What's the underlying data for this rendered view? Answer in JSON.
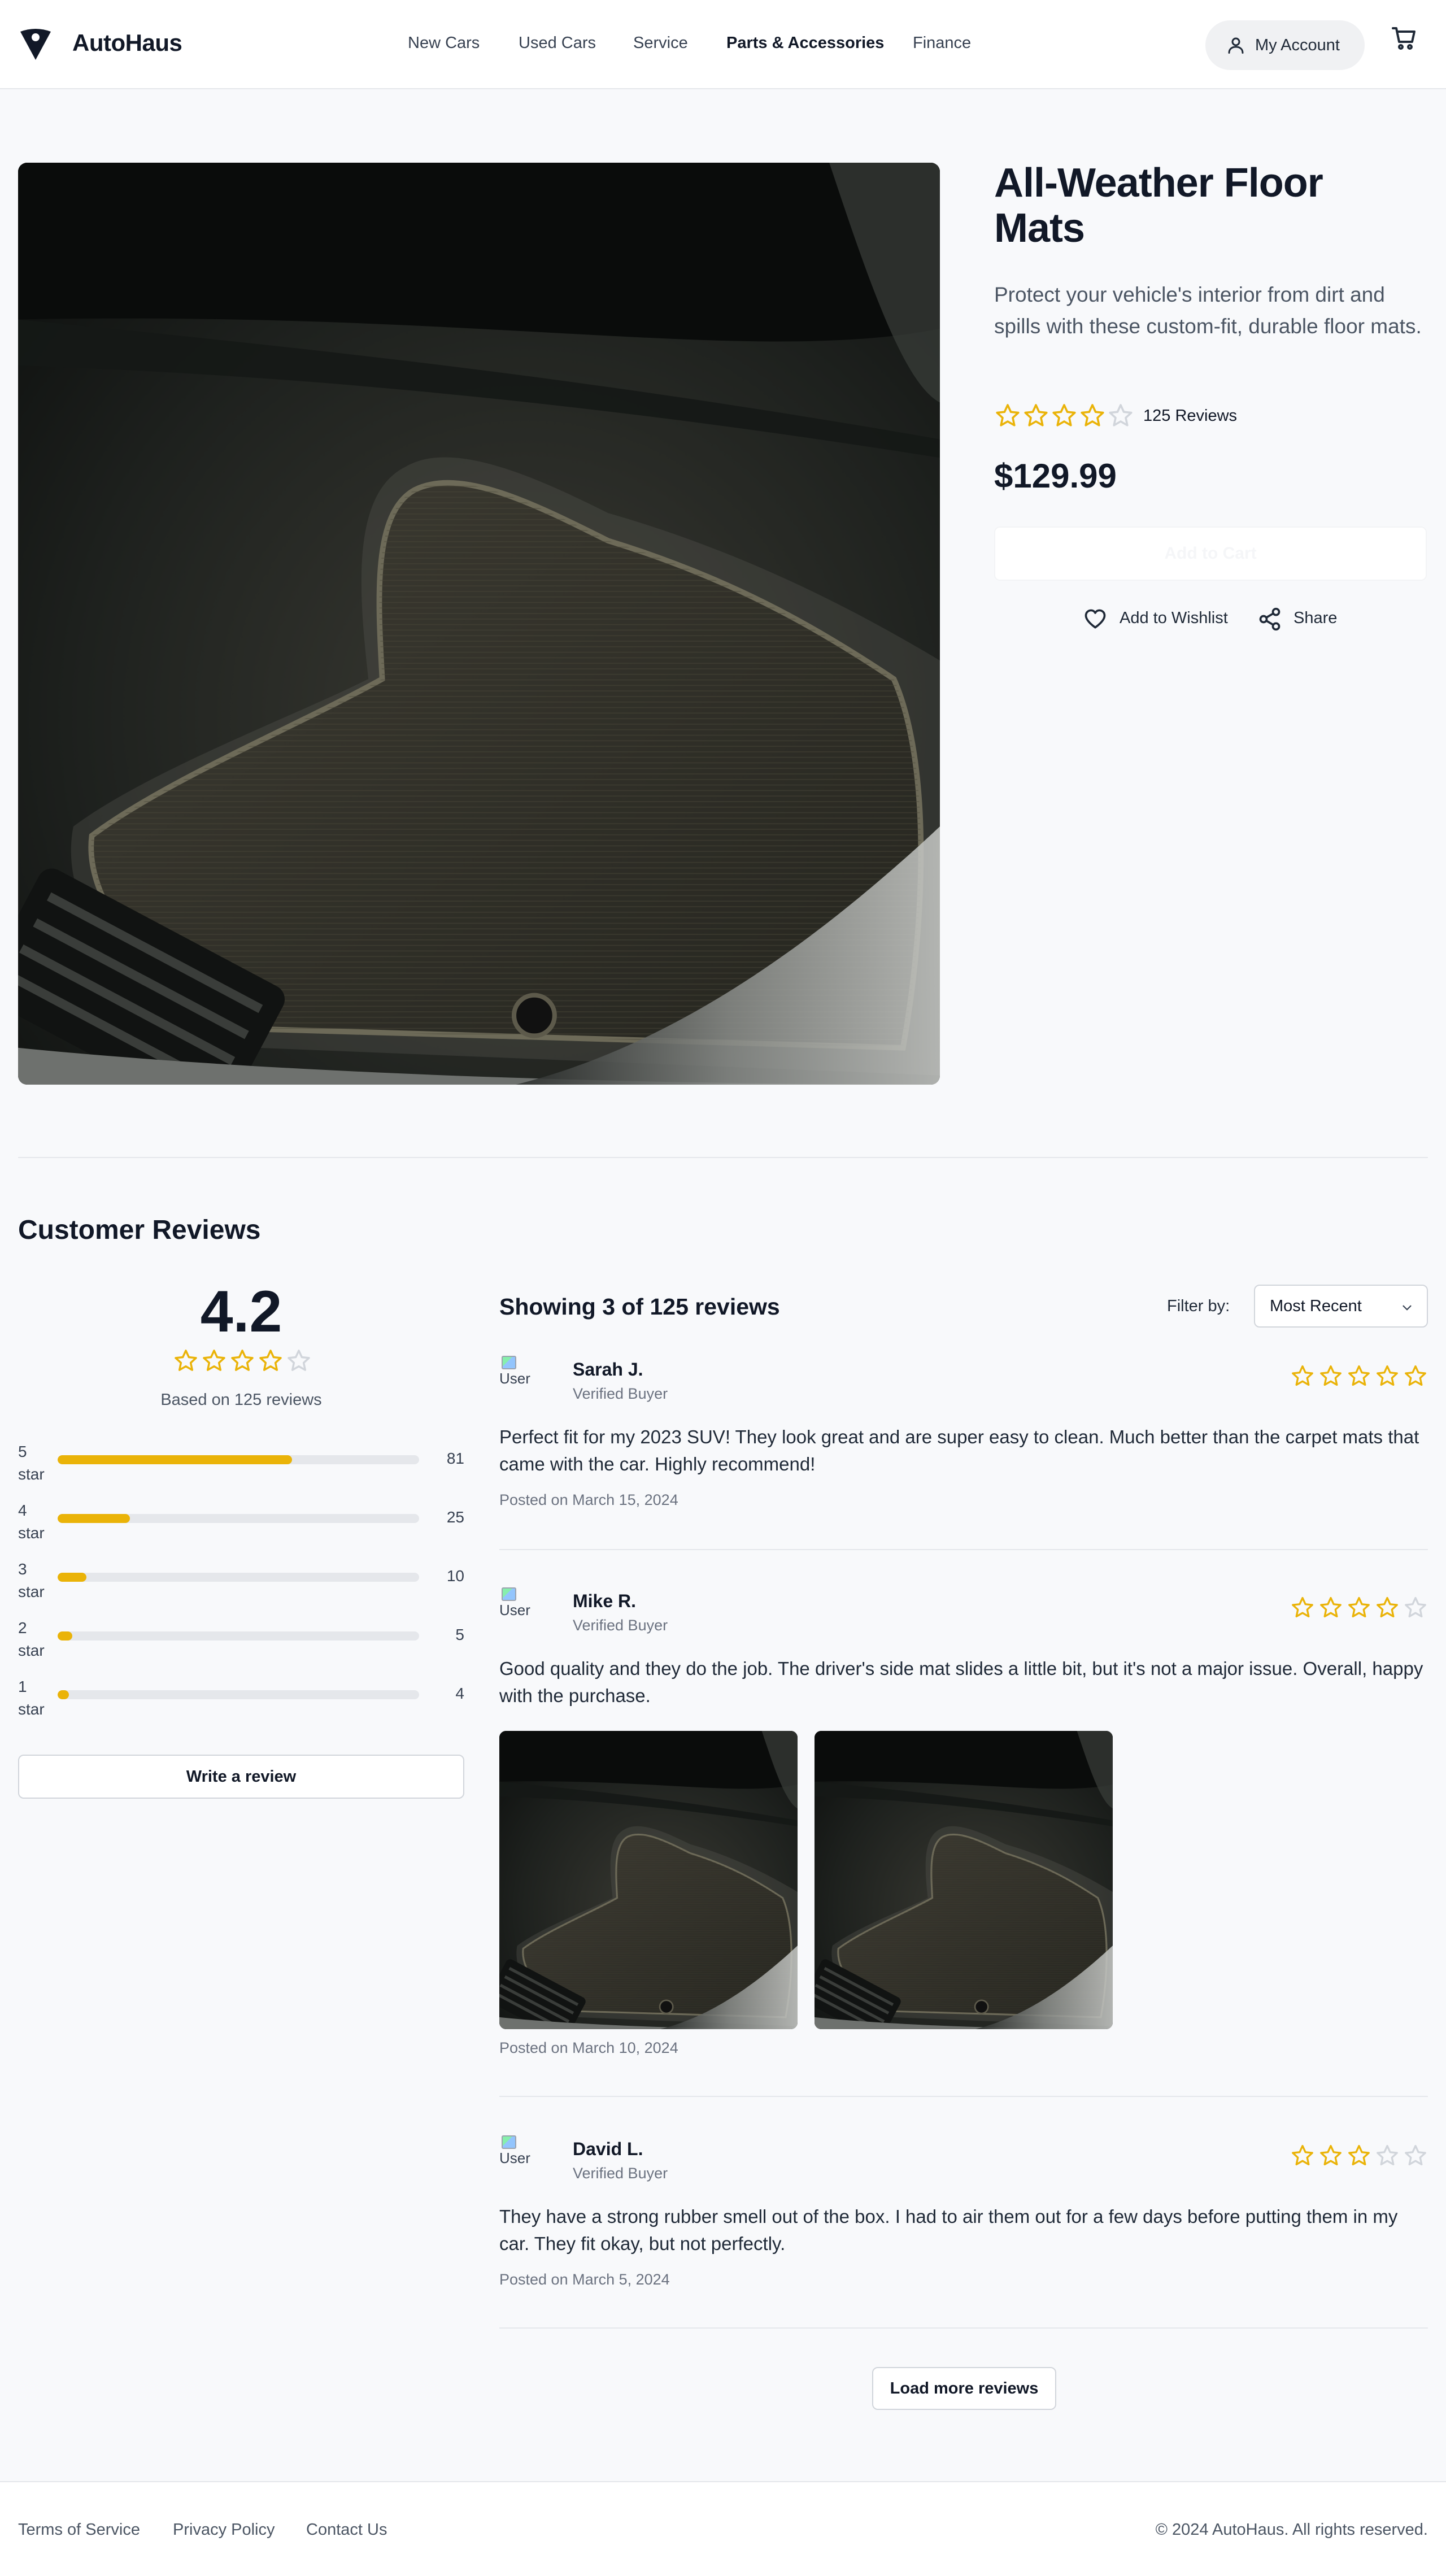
{
  "brand": {
    "name": "AutoHaus"
  },
  "nav": {
    "links": [
      {
        "label": "New Cars",
        "active": false
      },
      {
        "label": "Used Cars",
        "active": false
      },
      {
        "label": "Service",
        "active": false
      },
      {
        "label": "Parts & Accessories",
        "active": true
      },
      {
        "label": "Finance",
        "active": false
      }
    ],
    "account_label": "My Account"
  },
  "product": {
    "title": "All-Weather Floor Mats",
    "description": "Protect your vehicle's interior from dirt and spills with these custom-fit, durable floor mats.",
    "rating": 4,
    "reviews_label": "125 Reviews",
    "price": "$129.99",
    "add_to_cart_label": "Add to Cart",
    "wishlist_label": "Add to Wishlist",
    "share_label": "Share"
  },
  "reviews_summary": {
    "heading": "Customer Reviews",
    "average": "4.2",
    "average_stars": 4,
    "based_on": "Based on 125 reviews",
    "distribution": [
      {
        "label": "5 star",
        "count": "81",
        "fraction": 0.648
      },
      {
        "label": "4 star",
        "count": "25",
        "fraction": 0.2
      },
      {
        "label": "3 star",
        "count": "10",
        "fraction": 0.08
      },
      {
        "label": "2 star",
        "count": "5",
        "fraction": 0.04
      },
      {
        "label": "1 star",
        "count": "4",
        "fraction": 0.032
      }
    ],
    "write_review_label": "Write a review"
  },
  "reviews_list": {
    "showing": "Showing 3 of 125 reviews",
    "filter_label": "Filter by:",
    "filter_value": "Most Recent",
    "avatar_alt": "User",
    "items": [
      {
        "name": "Sarah J.",
        "verified": "Verified Buyer",
        "stars": 5,
        "body": "Perfect fit for my 2023 SUV! They look great and are super easy to clean. Much better than the carpet mats that came with the car. Highly recommend!",
        "posted": "Posted on March 15, 2024"
      },
      {
        "name": "Mike R.",
        "verified": "Verified Buyer",
        "stars": 4,
        "body": "Good quality and they do the job. The driver's side mat slides a little bit, but it's not a major issue. Overall, happy with the purchase.",
        "posted": "Posted on March 10, 2024"
      },
      {
        "name": "David L.",
        "verified": "Verified Buyer",
        "stars": 3,
        "body": "They have a strong rubber smell out of the box. I had to air them out for a few days before putting them in my car. They fit okay, but not perfectly.",
        "posted": "Posted on March 5, 2024"
      }
    ],
    "load_more_label": "Load more reviews"
  },
  "footer": {
    "links": [
      "Terms of Service",
      "Privacy Policy",
      "Contact Us"
    ],
    "copyright": "© 2024 AutoHaus. All rights reserved."
  },
  "colors": {
    "star_filled": "#eab308",
    "star_empty": "#d1d5db",
    "text_primary": "#111827",
    "text_muted": "#6b7280",
    "background": "#f8f9fb"
  },
  "icons": {
    "logo": "shield-logo-icon",
    "account": "user-icon",
    "cart": "cart-icon",
    "wishlist": "heart-icon",
    "share": "share-icon",
    "dropdown": "chevron-down-icon",
    "rating": "star-icon"
  }
}
